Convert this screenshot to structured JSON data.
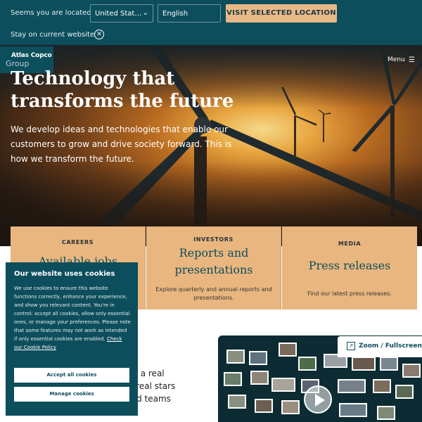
{
  "location_bar": {
    "label": "Seems you are located in:",
    "country": "United Stat…",
    "language": "English",
    "visit_button": "VISIT SELECTED LOCATION",
    "stay_label": "Stay on current website"
  },
  "header": {
    "logo_line1": "Atlas Copco",
    "logo_line2": "Group",
    "menu_label": "Menu"
  },
  "hero": {
    "title": "Technology that transforms the future",
    "description": "We develop ideas and technologies that enable our customers to grow and drive society forward. This is how we transform the future."
  },
  "cards": [
    {
      "kicker": "CAREERS",
      "title": "Available jobs",
      "description": ""
    },
    {
      "kicker": "INVESTORS",
      "title": "Reports and presentations",
      "description": "Explore quarterly and annual reports and presentations."
    },
    {
      "kicker": "MEDIA",
      "title": "Press releases",
      "description": "Find our latest press releases."
    }
  ],
  "content": {
    "partial_lines": [
      "ke a real",
      "e real stars",
      "ted teams",
      "e"
    ]
  },
  "video": {
    "zoom_label": "Zoom / Fullscreen"
  },
  "cookie": {
    "title": "Our website uses cookies",
    "body": "We use cookies to ensure this website functions correctly, enhance your experience, and show you relevant content. You're in control: accept all cookies, allow only essential ones, or manage your preferences. Please note that some features may not work as intended if only essential cookies are enabled.",
    "link": "Check our Cookie Policy",
    "accept_button": "Accept all cookies",
    "manage_button": "Manage cookies"
  },
  "colors": {
    "brand": "#0d4e5c",
    "accent": "#e9b887"
  },
  "icons": [
    "chevron-down-icon",
    "close-circle-icon",
    "hamburger-icon",
    "zoom-fullscreen-icon",
    "play-icon"
  ]
}
